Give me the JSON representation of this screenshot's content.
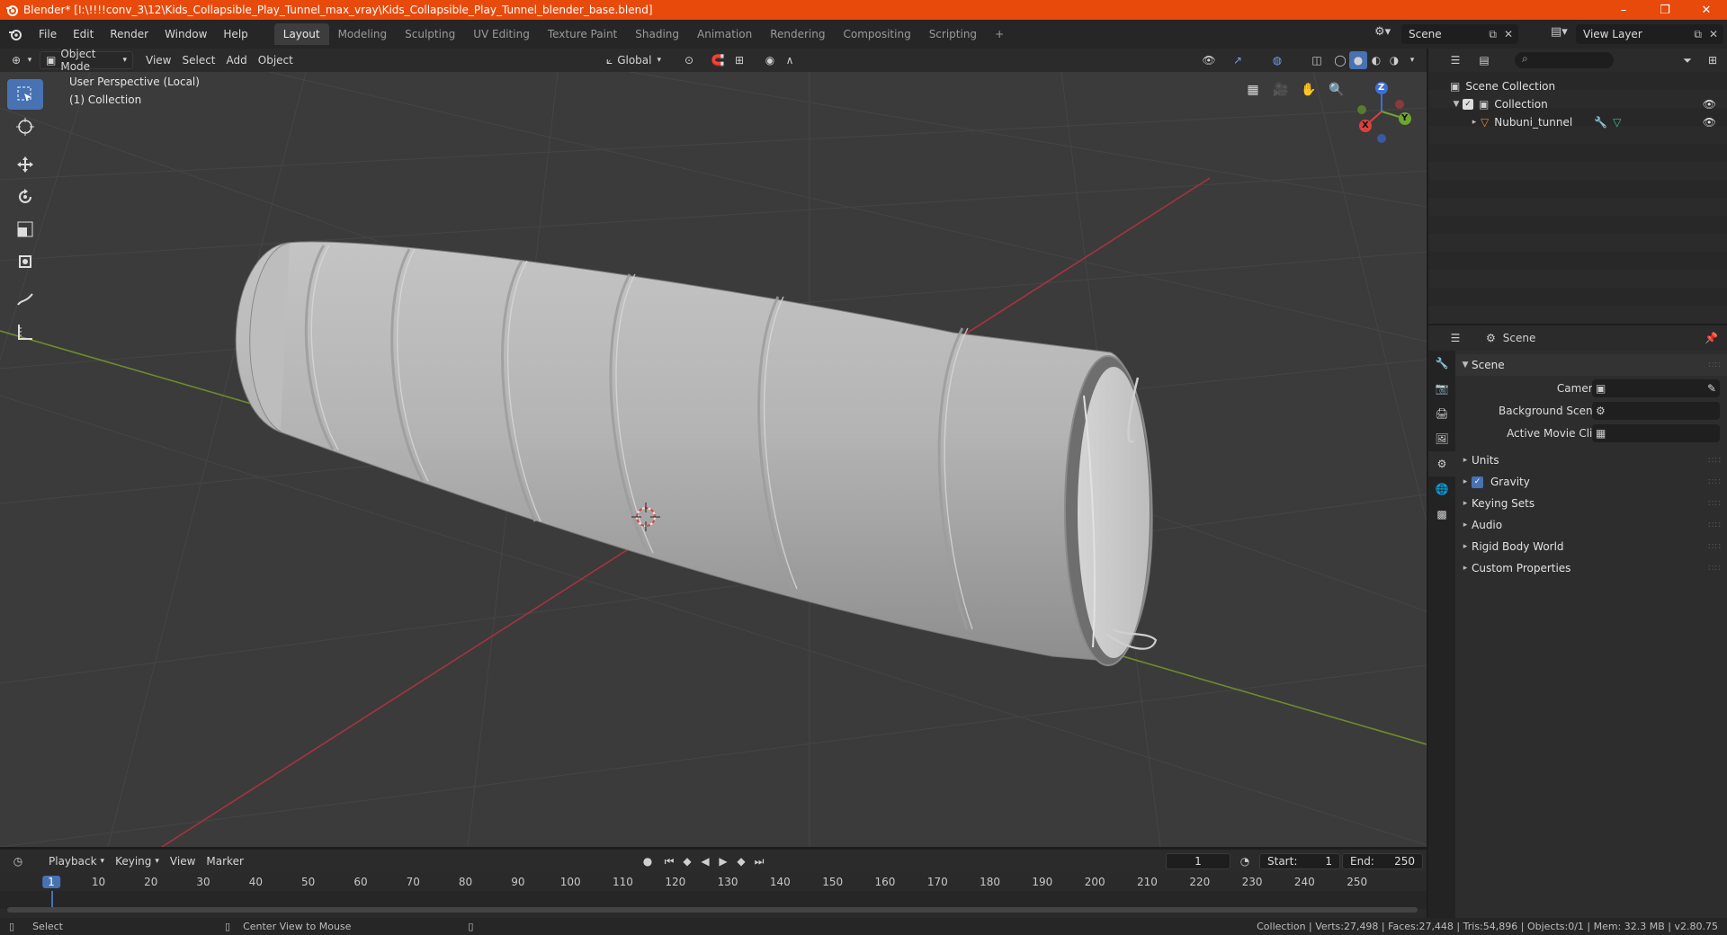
{
  "window": {
    "title": "Blender* [I:\\!!!!conv_3\\12\\Kids_Collapsible_Play_Tunnel_max_vray\\Kids_Collapsible_Play_Tunnel_blender_base.blend]",
    "minimize": "–",
    "maximize": "❐",
    "close": "✕"
  },
  "menu": [
    "File",
    "Edit",
    "Render",
    "Window",
    "Help"
  ],
  "workspaces": [
    {
      "label": "Layout",
      "active": true
    },
    {
      "label": "Modeling"
    },
    {
      "label": "Sculpting"
    },
    {
      "label": "UV Editing"
    },
    {
      "label": "Texture Paint"
    },
    {
      "label": "Shading"
    },
    {
      "label": "Animation"
    },
    {
      "label": "Rendering"
    },
    {
      "label": "Compositing"
    },
    {
      "label": "Scripting"
    }
  ],
  "add_workspace": "+",
  "scene_name": "Scene",
  "view_layer": "View Layer",
  "viewport_header": {
    "mode": "Object Mode",
    "menus": [
      "View",
      "Select",
      "Add",
      "Object"
    ],
    "transform_orientation": "Global"
  },
  "viewport": {
    "perspective_label": "User Perspective (Local)",
    "collection_label": "(1) Collection",
    "gizmo_axes": {
      "x": "X",
      "y": "Y",
      "z": "Z"
    },
    "colors": {
      "x_axis": "#a5343f",
      "y_axis": "#6d8d2a",
      "grid": "#454545",
      "background": "#3b3b3b"
    }
  },
  "outliner": {
    "root": "Scene Collection",
    "collection": "Collection",
    "object": "Nubuni_tunnel"
  },
  "properties": {
    "context": "Scene",
    "panel_title": "Scene",
    "fields": [
      {
        "label": "Camera"
      },
      {
        "label": "Background Scene"
      },
      {
        "label": "Active Movie Clip"
      }
    ],
    "subpanels": [
      {
        "label": "Units"
      },
      {
        "label": "Gravity",
        "checkbox": true,
        "checked": true
      },
      {
        "label": "Keying Sets"
      },
      {
        "label": "Audio"
      },
      {
        "label": "Rigid Body World"
      },
      {
        "label": "Custom Properties"
      }
    ]
  },
  "timeline": {
    "menus": [
      "Playback",
      "Keying",
      "View",
      "Marker"
    ],
    "current_frame": "1",
    "start_label": "Start:",
    "start": "1",
    "end_label": "End:",
    "end": "250",
    "ticks": [
      "1",
      "10",
      "20",
      "30",
      "40",
      "50",
      "60",
      "70",
      "80",
      "90",
      "100",
      "110",
      "120",
      "130",
      "140",
      "150",
      "160",
      "170",
      "180",
      "190",
      "200",
      "210",
      "220",
      "230",
      "240",
      "250"
    ]
  },
  "statusbar": {
    "select": "Select",
    "center_view": "Center View to Mouse",
    "stats": "Collection | Verts:27,498 | Faces:27,448 | Tris:54,896 | Objects:0/1 | Mem: 32.3 MB | v2.80.75"
  },
  "accent": "#4772b3"
}
